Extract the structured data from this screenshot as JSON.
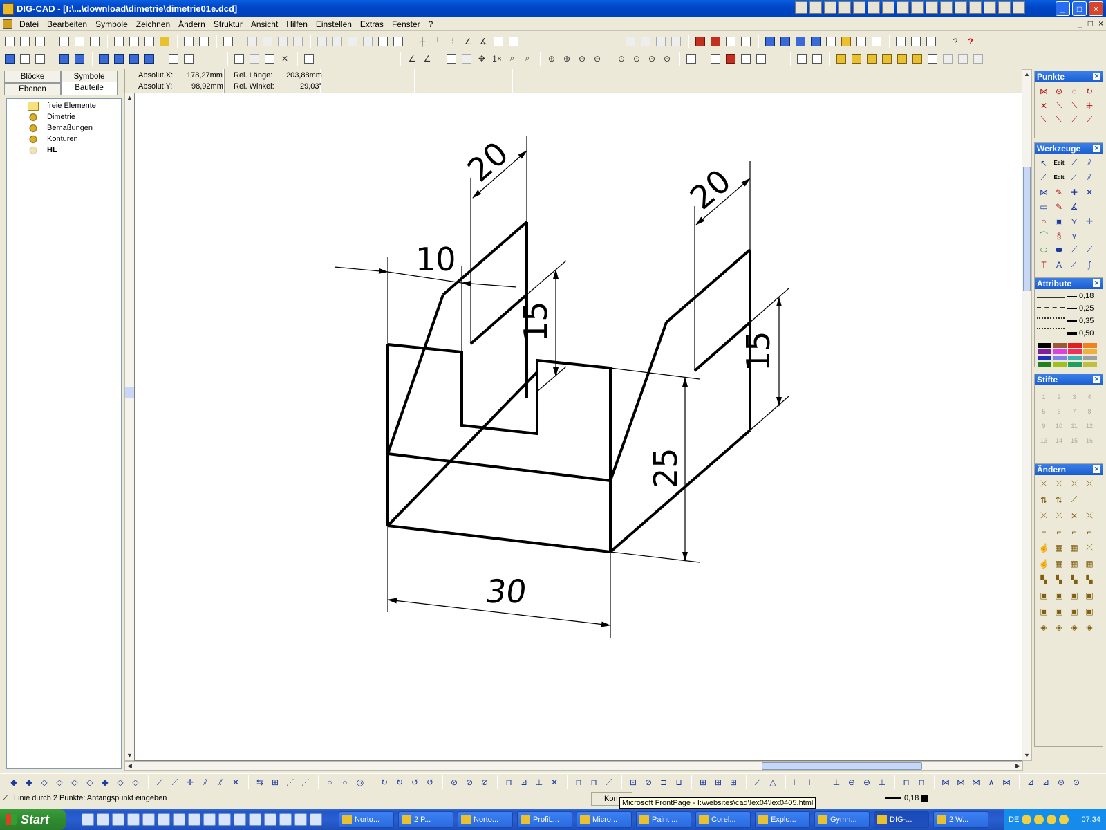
{
  "window": {
    "title": "DIG-CAD - [I:\\...\\download\\dimetrie\\dimetrie01e.dcd]",
    "controls": [
      "_",
      "□",
      "×"
    ]
  },
  "menu": {
    "items": [
      "Datei",
      "Bearbeiten",
      "Symbole",
      "Zeichnen",
      "Ändern",
      "Struktur",
      "Ansicht",
      "Hilfen",
      "Einstellen",
      "Extras",
      "Fenster",
      "?"
    ],
    "mdi_controls": [
      "_",
      "□",
      "×"
    ]
  },
  "left_panel": {
    "tabs": [
      "Blöcke",
      "Symbole",
      "Ebenen",
      "Bauteile"
    ],
    "active_tab": "Bauteile",
    "tree": [
      {
        "label": "freie Elemente",
        "icon": "folder-icon"
      },
      {
        "label": "Dimetrie",
        "icon": "gears-icon"
      },
      {
        "label": "Bemaßungen",
        "icon": "gears-icon"
      },
      {
        "label": "Konturen",
        "icon": "gears-icon"
      },
      {
        "label": "HL",
        "icon": "gears-gray-icon"
      }
    ]
  },
  "coords": {
    "abs_x_label": "Absolut X:",
    "abs_x_value": "178,27mm",
    "abs_y_label": "Absolut Y:",
    "abs_y_value": "98,92mm",
    "rel_len_label": "Rel. Länge:",
    "rel_len_value": "203,88mm",
    "rel_angle_label": "Rel. Winkel:",
    "rel_angle_value": "29,03°"
  },
  "drawing": {
    "dims": {
      "d1": "20",
      "d2": "20",
      "d3": "10",
      "d4": "15",
      "d5": "15",
      "d6": "25",
      "d7": "30"
    }
  },
  "right_panel": {
    "punkte_title": "Punkte",
    "werkzeuge_title": "Werkzeuge",
    "werkzeuge_edit1": "Edit",
    "werkzeuge_edit2": "Edit",
    "attribute_title": "Attribute",
    "line_widths": [
      "0,18",
      "0,25",
      "0,35",
      "0,50"
    ],
    "colors": [
      "#000000",
      "#9a5a3a",
      "#e02020",
      "#f08020",
      "#8020a0",
      "#e040e0",
      "#f03060",
      "#f0b040",
      "#2030c0",
      "#8080f0",
      "#40b0b0",
      "#a0a0a0",
      "#208020",
      "#a0c020",
      "#20a060",
      "#c0c040"
    ],
    "stifte_title": "Stifte",
    "stifte": [
      "1",
      "2",
      "3",
      "4",
      "5",
      "6",
      "7",
      "8",
      "9",
      "10",
      "11",
      "12",
      "13",
      "14",
      "15",
      "16"
    ],
    "aendern_title": "Ändern"
  },
  "status": {
    "message": "Linie durch 2 Punkte: Anfangspunkt eingeben",
    "field": "Kon",
    "pen_width": "0,18",
    "tooltip": "Microsoft FrontPage - I:\\websites\\cad\\lex04\\lex0405.html"
  },
  "taskbar": {
    "start_label": "Start",
    "tasks": [
      "Norto...",
      "2 P...",
      "Norto...",
      "ProfiL...",
      "Micro...",
      "Paint ...",
      "Corel...",
      "Explo...",
      "Gymn...",
      "DIG-...",
      "2 W..."
    ],
    "active_task": "DIG-...",
    "lang": "DE",
    "clock": "07:34"
  }
}
